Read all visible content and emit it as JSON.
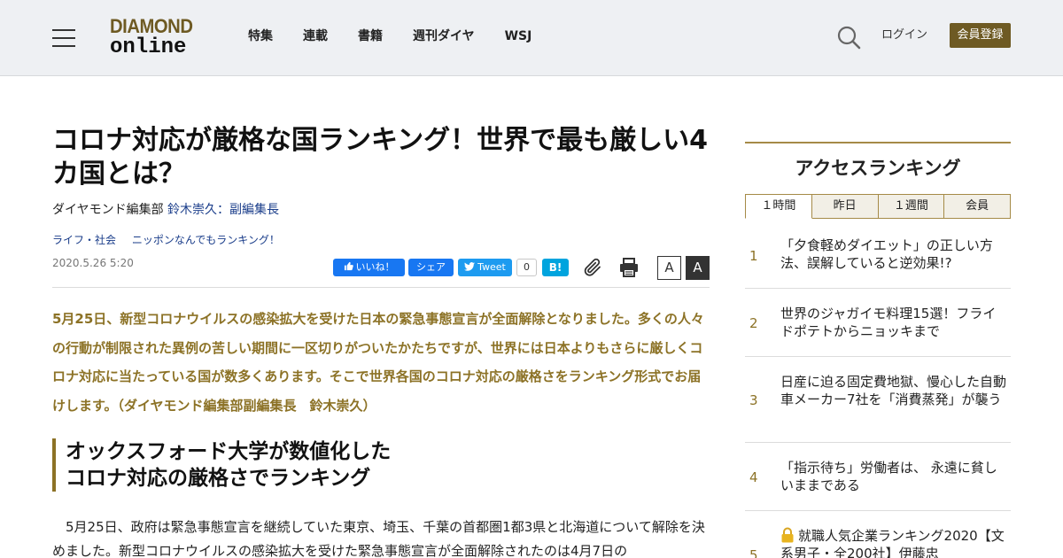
{
  "header": {
    "logo_line1": "DIAMOND",
    "logo_line2": "online",
    "nav": [
      "特集",
      "連載",
      "書籍",
      "週刊ダイヤ",
      "WSJ"
    ],
    "login": "ログイン",
    "register": "会員登録"
  },
  "article": {
    "title": "コロナ対応が厳格な国ランキング！世界で最も厳しい4カ国とは？",
    "byline_dept": "ダイヤモンド編集部 ",
    "byline_author": "鈴木崇久：副編集長",
    "tags": [
      "ライフ・社会",
      "ニッポンなんでもランキング！"
    ],
    "date": "2020.5.26 5:20",
    "lead": "5月25日、新型コロナウイルスの感染拡大を受けた日本の緊急事態宣言が全面解除となりました。多くの人々の行動が制限された異例の苦しい期間に一区切りがついたかたちですが、世界には日本よりもさらに厳しくコロナ対応に当たっている国が数多くあります。そこで世界各国のコロナ対応の厳格さをランキング形式でお届けします。（ダイヤモンド編集部副編集長　鈴木崇久）",
    "subhead_line1": "オックスフォード大学が数値化した",
    "subhead_line2": "コロナ対応の厳格さでランキング",
    "body": "5月25日、政府は緊急事態宣言を継続していた東京、埼玉、千葉の首都圏1都3県と北海道について解除を決めました。新型コロナウイルスの感染拡大を受けた緊急事態宣言が全面解除されたのは4月7日の"
  },
  "share": {
    "fb_like": "いいね！",
    "fb_share": "シェア",
    "tweet": "Tweet",
    "tweet_count": "0",
    "hatena": "B!",
    "font_small": "A",
    "font_large": "A"
  },
  "sidebar": {
    "title": "アクセスランキング",
    "tabs": [
      "１時間",
      "昨日",
      "１週間",
      "会員"
    ],
    "ranking": [
      {
        "num": "1",
        "text": "「夕食軽めダイエット」の正しい方法、誤解していると逆効果!?"
      },
      {
        "num": "2",
        "text": "世界のジャガイモ料理15選！フライドポテトからニョッキまで"
      },
      {
        "num": "3",
        "text": "日産に迫る固定費地獄、慢心した自動車メーカー7社を「消費蒸発」が襲う"
      },
      {
        "num": "4",
        "text": "「指示待ち」労働者は、 永遠に貧しいままである"
      },
      {
        "num": "5",
        "text": "就職人気企業ランキング2020【文系男子・全200社】伊藤忠"
      }
    ]
  },
  "colors": {
    "brand": "#6e5a23",
    "lead_text": "#8c7226",
    "link": "#1a3d8a"
  }
}
